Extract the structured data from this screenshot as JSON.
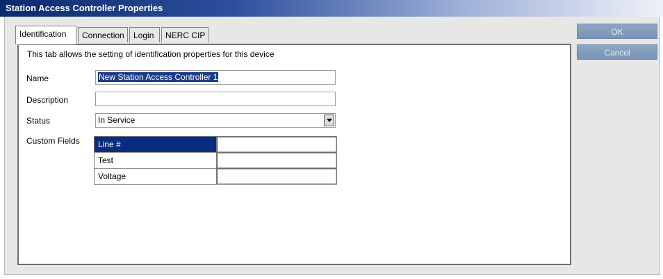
{
  "window": {
    "title": "Station Access Controller Properties"
  },
  "tabs": [
    {
      "label": "Identification",
      "active": true
    },
    {
      "label": "Connection",
      "active": false
    },
    {
      "label": "Login",
      "active": false
    },
    {
      "label": "NERC CIP",
      "active": false
    }
  ],
  "identification": {
    "description": "This tab allows the setting of identification properties for this device",
    "name_label": "Name",
    "name_value": "New Station Access Controller 1",
    "description_label": "Description",
    "description_value": "",
    "status_label": "Status",
    "status_value": "In Service",
    "custom_fields_label": "Custom Fields",
    "custom_fields": [
      {
        "key": "Line #",
        "value": "",
        "selected": true
      },
      {
        "key": "Test",
        "value": ""
      },
      {
        "key": "Voltage",
        "value": ""
      }
    ]
  },
  "buttons": {
    "ok": "OK",
    "cancel": "Cancel"
  },
  "colors": {
    "selection": "#0a2c80",
    "button": "#8199ba",
    "titlebar_start": "#0a2a6e"
  }
}
